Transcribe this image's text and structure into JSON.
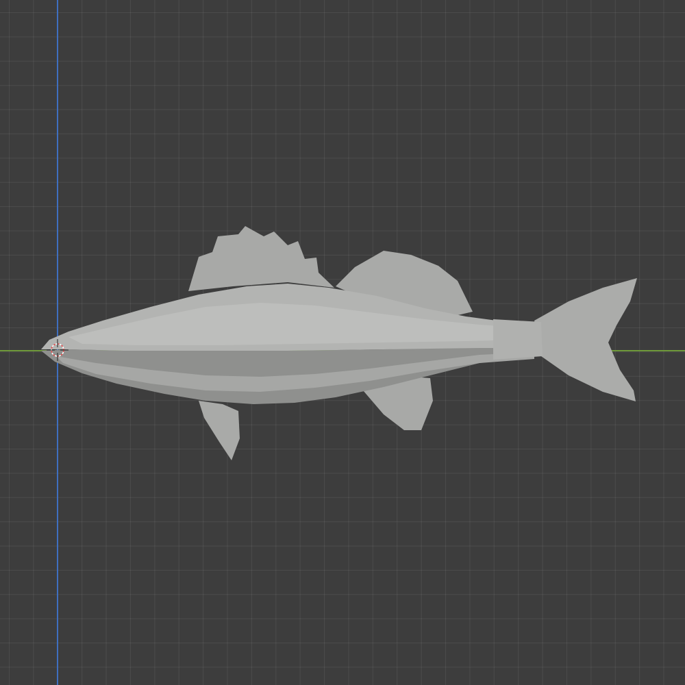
{
  "viewport": {
    "background_color": "#3d3d3d",
    "grid_color": "#4a4a4a",
    "x_axis_color": "#6f9a3a",
    "y_axis_color": "#3f6fc0"
  },
  "model": {
    "body_color": "#b4b5b3",
    "fin_color": "#a9aaa8",
    "shadow_color": "#8e8f8d"
  },
  "cursor": {
    "icon": "3d-cursor-icon",
    "ring_colors": [
      "#e05050",
      "#ffffff"
    ]
  }
}
